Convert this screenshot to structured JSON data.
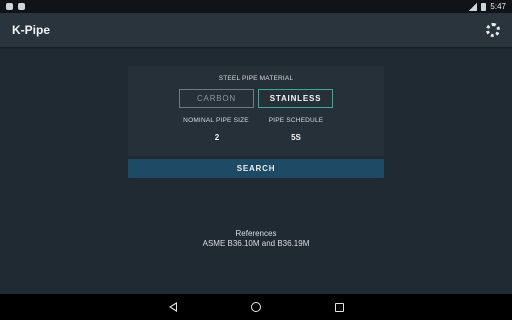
{
  "status_bar": {
    "time": "5:47",
    "icons": [
      "notification-icon",
      "android-icon",
      "signal-icon",
      "battery-icon"
    ]
  },
  "toolbar": {
    "title": "K-Pipe",
    "settings_icon": "gear-icon"
  },
  "form": {
    "material_label": "STEEL PIPE MATERIAL",
    "material_options": [
      "CARBON",
      "STAINLESS"
    ],
    "material_selected": "STAINLESS",
    "size_label": "NOMINAL PIPE SIZE",
    "size_value": "2",
    "schedule_label": "PIPE SCHEDULE",
    "schedule_value": "5S",
    "search_label": "SEARCH"
  },
  "references": {
    "heading": "References",
    "text": "ASME B36.10M and B36.19M"
  },
  "nav_bar": {
    "icons": [
      "back-icon",
      "home-icon",
      "recents-icon"
    ]
  },
  "colors": {
    "background": "#202a33",
    "toolbar": "#2a343d",
    "accent": "#3fa79a",
    "search_button": "#1f4a66"
  }
}
